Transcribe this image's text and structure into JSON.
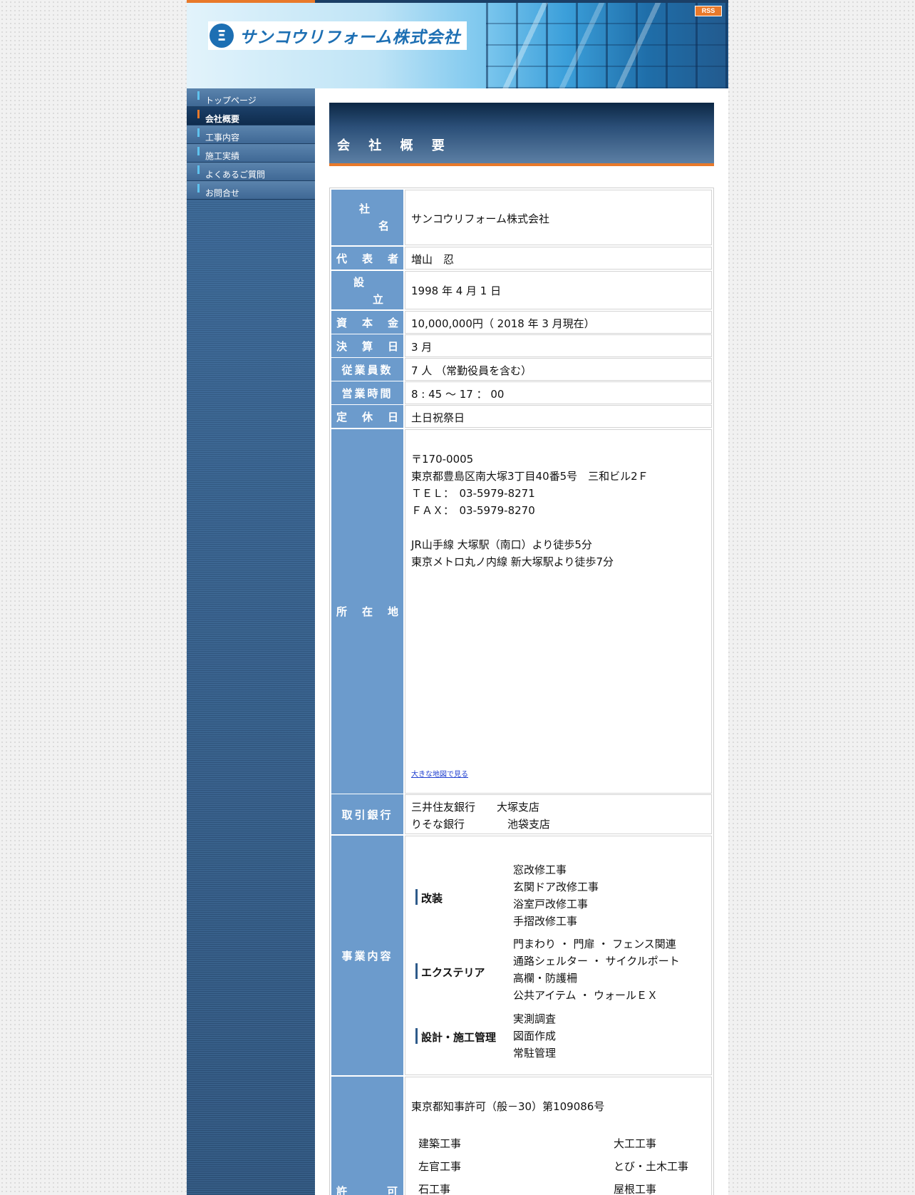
{
  "header": {
    "company_logo": "サンコウリフォーム株式会社",
    "rss_label": "RSS"
  },
  "sidebar": {
    "items": [
      {
        "label": "トップページ"
      },
      {
        "label": "会社概要"
      },
      {
        "label": "工事内容"
      },
      {
        "label": "施工実績"
      },
      {
        "label": "よくあるご質問"
      },
      {
        "label": "お問合せ"
      }
    ]
  },
  "main": {
    "title": "会 社 概 要",
    "rows": {
      "company_name": {
        "label_a": "社",
        "label_b": "名",
        "value": "サンコウリフォーム株式会社"
      },
      "representative": {
        "label": [
          "代",
          "表",
          "者"
        ],
        "value": "増山　忍"
      },
      "established": {
        "label_a": "設",
        "label_b": "立",
        "value": "1998 年 4 月 1 日"
      },
      "capital": {
        "label": [
          "資",
          "本",
          "金"
        ],
        "value": "10,000,000円（ 2018 年  3 月現在）"
      },
      "fiscal": {
        "label": [
          "決",
          "算",
          "日"
        ],
        "value": "3 月"
      },
      "employees": {
        "label": "従業員数",
        "value": "7 人 （常勤役員を含む）"
      },
      "hours": {
        "label": "営業時間",
        "value": "8 : 45 ～ 17 ： 00"
      },
      "holidays": {
        "label": [
          "定",
          "休",
          "日"
        ],
        "value": "土日祝祭日"
      },
      "address": {
        "label": [
          "所",
          "在",
          "地"
        ],
        "lines": [
          "〒170-0005",
          "東京都豊島区南大塚3丁目40番5号　三和ビル2Ｆ",
          "ＴＥＬ：　03-5979-8271",
          "ＦＡＸ：　03-5979-8270",
          "JR山手線 大塚駅（南口）より徒歩5分",
          "東京メトロ丸ノ内線 新大塚駅より徒歩7分"
        ],
        "map_link": "大きな地図で見る"
      },
      "banks": {
        "label": "取引銀行",
        "lines": [
          "三井住友銀行　　大塚支店",
          "りそな銀行　　　　池袋支店"
        ]
      },
      "business": {
        "label": "事業内容",
        "categories": [
          {
            "name": "改装",
            "items": [
              "窓改修工事",
              "玄関ドア改修工事",
              "浴室戸改修工事",
              "手摺改修工事"
            ]
          },
          {
            "name": "エクステリア",
            "items": [
              "門まわり ・ 門扉 ・ フェンス関連",
              "通路シェルター ・ サイクルポート",
              "高欄・防護柵",
              "公共アイテム ・ ウォールＥＸ"
            ]
          },
          {
            "name": "設計・施工管理",
            "items": [
              "実測調査",
              "図面作成",
              "常駐管理"
            ]
          }
        ]
      },
      "license": {
        "label": [
          "許",
          "可"
        ],
        "number": "東京都知事許可（般－30）第109086号",
        "left": [
          "建築工事",
          "左官工事",
          "石工事"
        ],
        "right": [
          "大工工事",
          "とび・土木工事",
          "屋根工事"
        ]
      }
    }
  }
}
